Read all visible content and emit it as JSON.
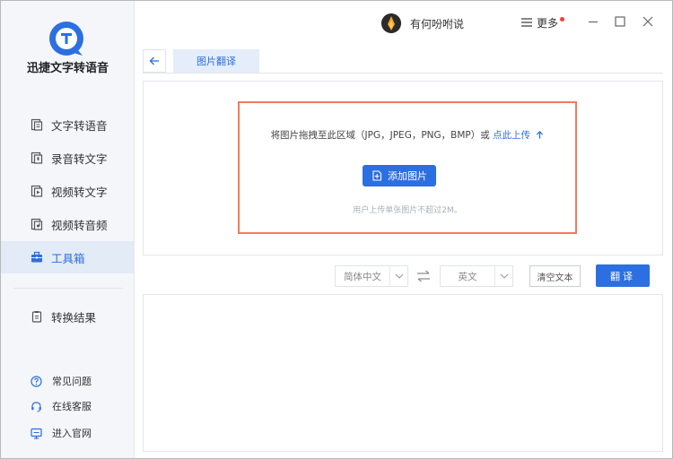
{
  "app": {
    "name": "迅捷文字转语音",
    "colors": {
      "accent": "#2c6fe0",
      "dropzone_border": "#f27b5d",
      "sidebar_bg": "#f4f6f9",
      "notify_dot": "#ff3b30"
    }
  },
  "sidebar": {
    "items": [
      {
        "label": "文字转语音",
        "icon": "text-doc-icon",
        "active": false
      },
      {
        "label": "录音转文字",
        "icon": "record-icon",
        "active": false
      },
      {
        "label": "视频转文字",
        "icon": "video-icon",
        "active": false
      },
      {
        "label": "视频转音频",
        "icon": "video-audio-icon",
        "active": false
      },
      {
        "label": "工具箱",
        "icon": "toolbox-icon",
        "active": true
      },
      {
        "label": "转换结果",
        "icon": "result-icon",
        "active": false
      }
    ],
    "footer": [
      {
        "label": "常见问题",
        "icon": "question-icon"
      },
      {
        "label": "在线客服",
        "icon": "headset-icon"
      },
      {
        "label": "进入官网",
        "icon": "monitor-icon"
      }
    ]
  },
  "titlebar": {
    "user_name": "有何吩咐说",
    "more_label": "更多"
  },
  "tabs": [
    {
      "label": "图片翻译"
    }
  ],
  "upload": {
    "drop_text": "将图片拖拽至此区域（JPG，JPEG，PNG，BMP）或",
    "upload_link": "点此上传",
    "add_button": "添加图片",
    "hint": "用户上传单张图片不超过2M。"
  },
  "translate": {
    "source_lang": "简体中文",
    "target_lang": "英文",
    "clear_label": "清空文本",
    "translate_label": "翻译"
  }
}
